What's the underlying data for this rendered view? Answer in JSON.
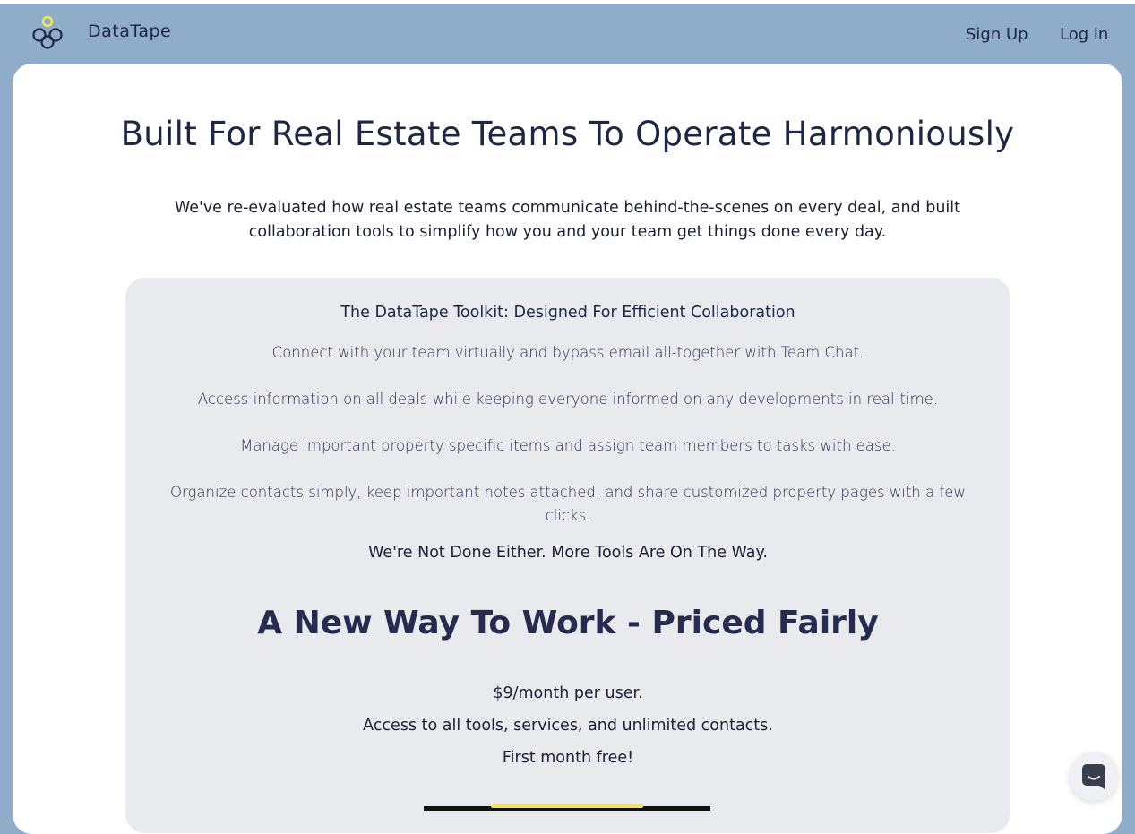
{
  "header": {
    "brand": "DataTape",
    "nav": {
      "signup": "Sign Up",
      "login": "Log in"
    }
  },
  "hero": {
    "title": "Built For Real Estate Teams To Operate Harmoniously",
    "subtitle": "We've re-evaluated how real estate teams communicate behind-the-scenes on every deal, and built collaboration tools to simplify how you and your team get things done every day."
  },
  "toolkit": {
    "title": "The DataTape Toolkit: Designed For Efficient Collaboration",
    "features": [
      "Connect with your team virtually and bypass email all-together with Team Chat.",
      "Access information on all deals while keeping everyone informed on any developments in real-time.",
      "Manage important property specific items and assign team members to tasks with ease.",
      "Organize contacts simply, keep important notes attached, and share customized property pages with a few clicks."
    ],
    "more": "We're Not Done Either. More Tools Are On The Way."
  },
  "pricing": {
    "title": "A New Way To Work - Priced Fairly",
    "lines": [
      "$9/month per user.",
      "Access to all tools, services, and unlimited contacts.",
      "First month free!"
    ]
  },
  "colors": {
    "background": "#8fadc9",
    "card": "#ffffff",
    "panel": "#e9eaed",
    "text_dark": "#1e2645",
    "accent_yellow": "#f0e16a"
  },
  "icons": {
    "logo": "datatape-logo-icon",
    "chat": "chat-icon"
  }
}
